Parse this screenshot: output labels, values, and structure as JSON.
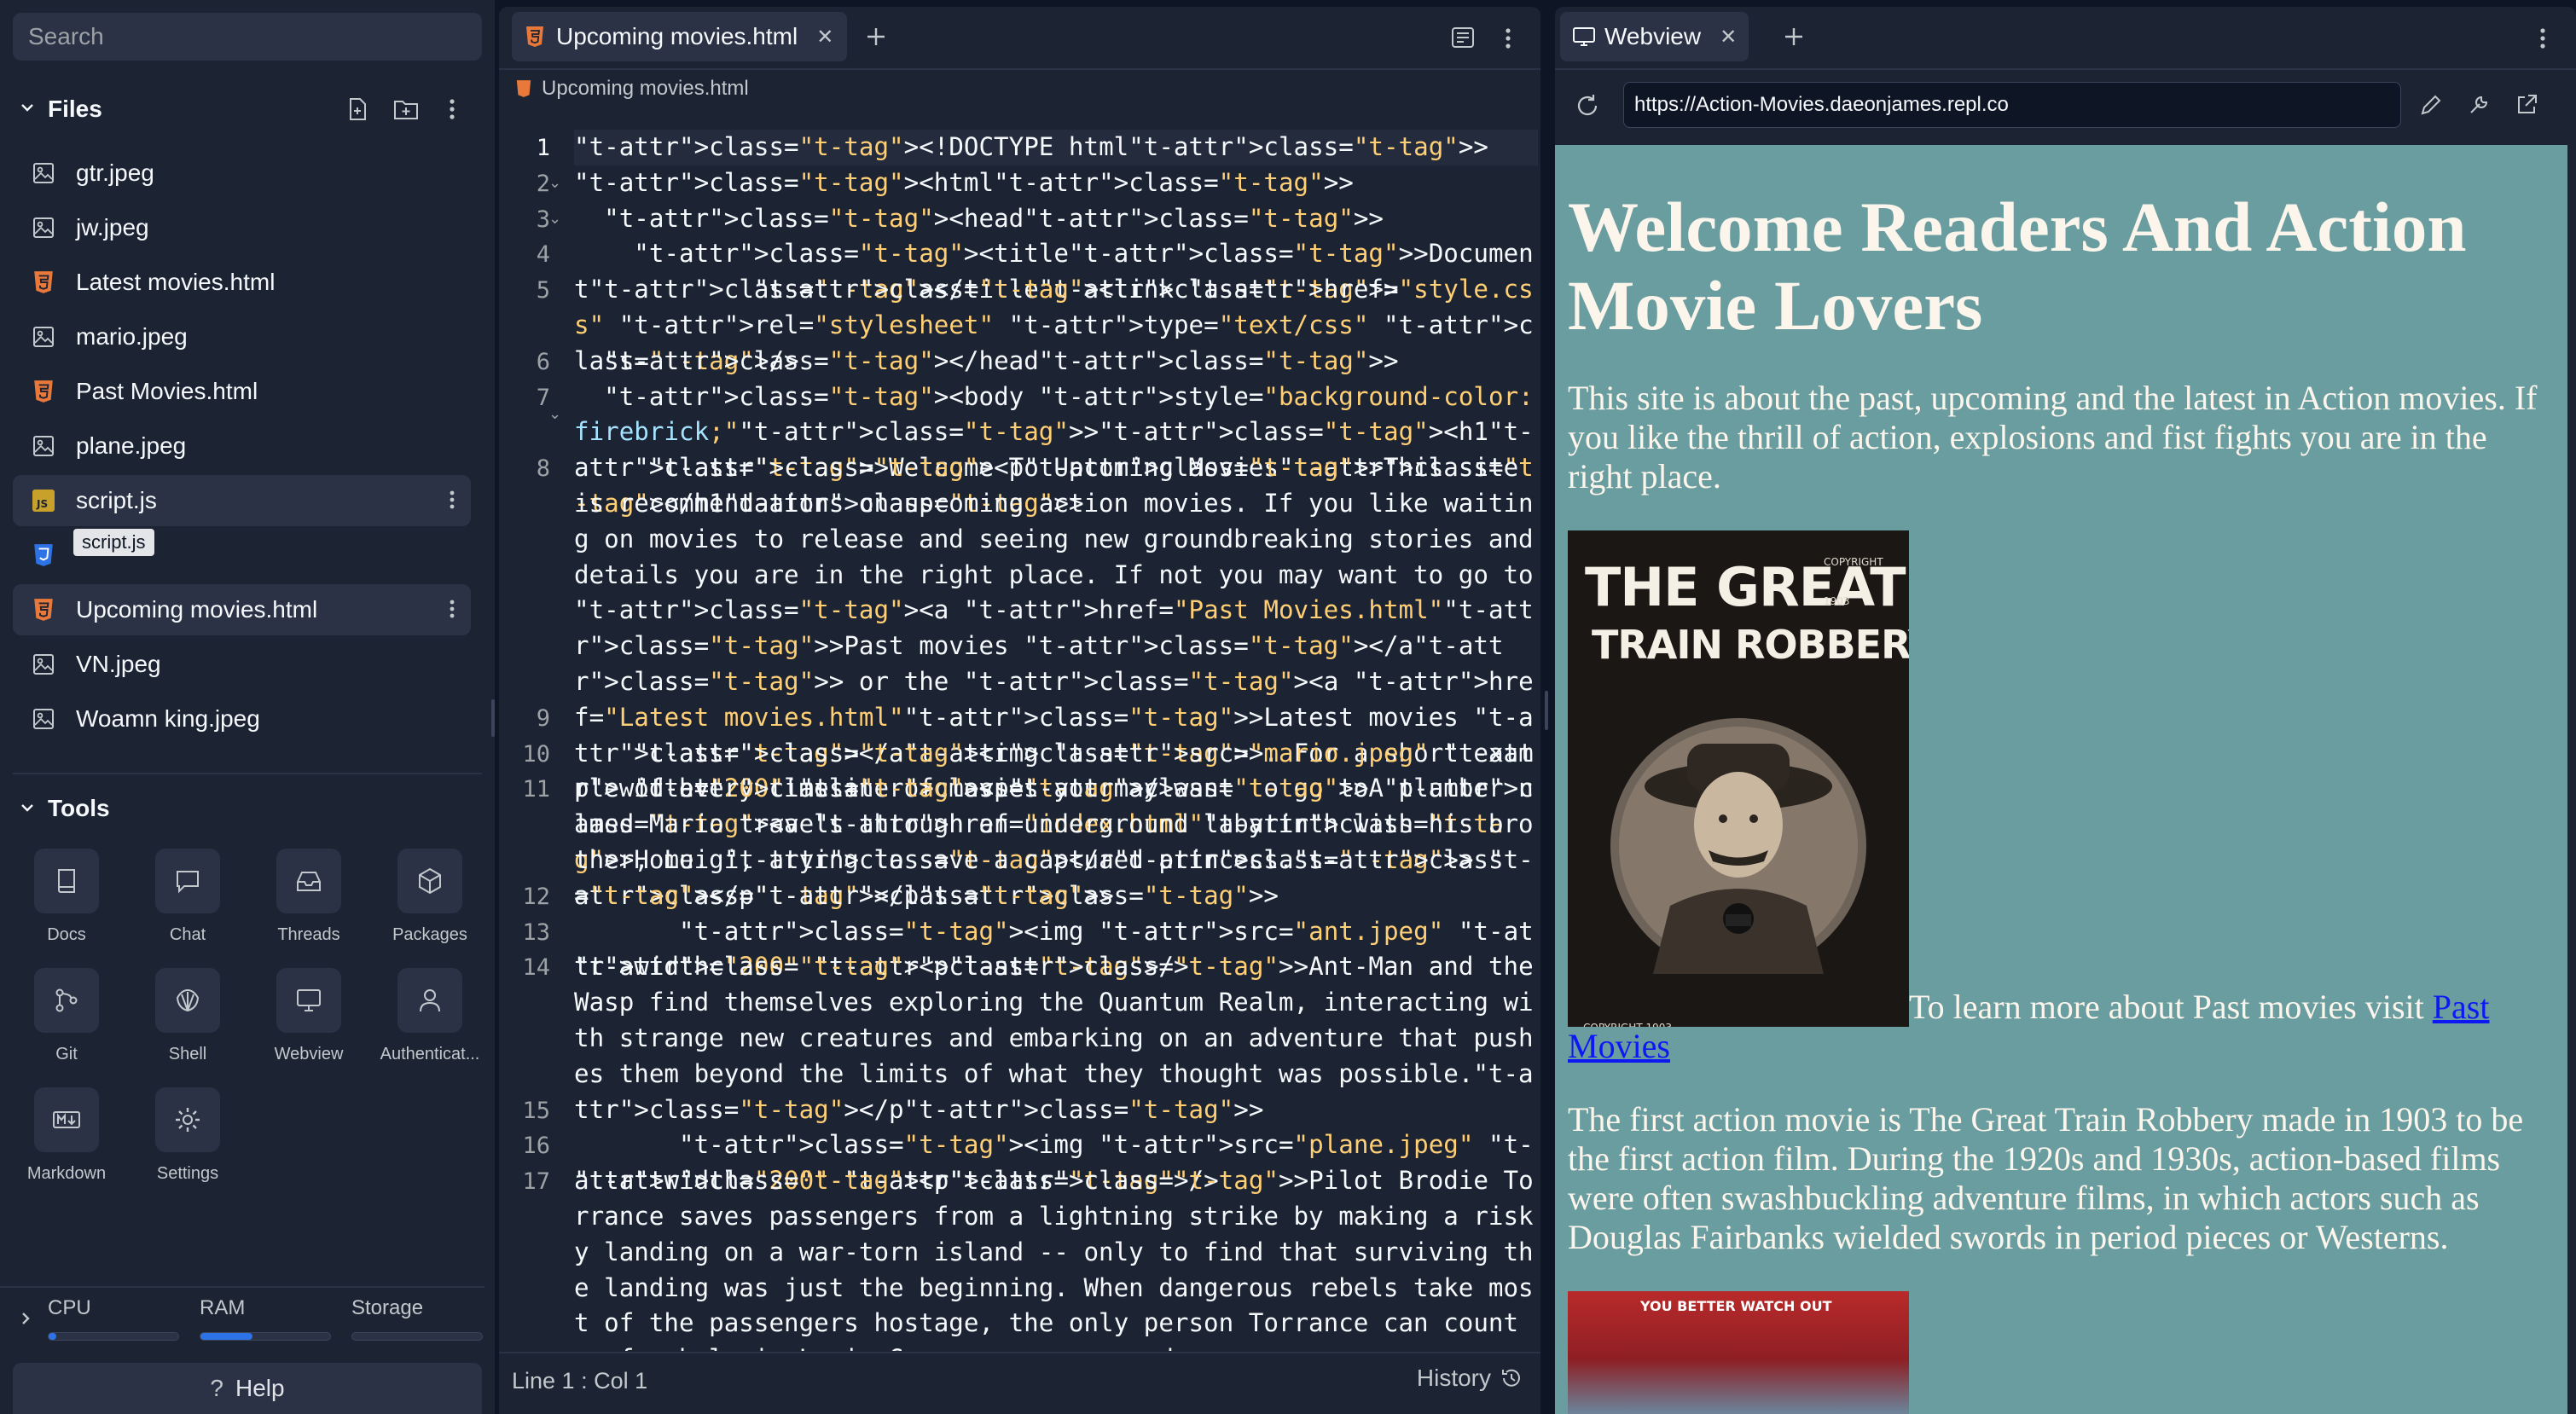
{
  "sidebar": {
    "search_placeholder": "Search",
    "files_header": "Files",
    "files": [
      {
        "name": "gtr.jpeg",
        "kind": "image"
      },
      {
        "name": "jw.jpeg",
        "kind": "image"
      },
      {
        "name": "Latest movies.html",
        "kind": "html"
      },
      {
        "name": "mario.jpeg",
        "kind": "image"
      },
      {
        "name": "Past Movies.html",
        "kind": "html"
      },
      {
        "name": "plane.jpeg",
        "kind": "image"
      },
      {
        "name": "script.js",
        "kind": "js"
      },
      {
        "name": "",
        "kind": "css"
      },
      {
        "name": "Upcoming movies.html",
        "kind": "html"
      },
      {
        "name": "VN.jpeg",
        "kind": "image"
      },
      {
        "name": "Woamn king.jpeg",
        "kind": "image"
      }
    ],
    "tooltip": "script.js",
    "tools_header": "Tools",
    "tools": [
      {
        "label": "Docs",
        "icon": "book-icon"
      },
      {
        "label": "Chat",
        "icon": "chat-icon"
      },
      {
        "label": "Threads",
        "icon": "inbox-icon"
      },
      {
        "label": "Packages",
        "icon": "package-icon"
      },
      {
        "label": "Git",
        "icon": "git-icon"
      },
      {
        "label": "Shell",
        "icon": "shell-icon"
      },
      {
        "label": "Webview",
        "icon": "monitor-icon"
      },
      {
        "label": "Authenticat...",
        "icon": "user-icon"
      },
      {
        "label": "Markdown",
        "icon": "markdown-icon"
      },
      {
        "label": "Settings",
        "icon": "gear-icon"
      }
    ],
    "resources": {
      "cpu_label": "CPU",
      "cpu_level": 0.06,
      "ram_label": "RAM",
      "ram_level": 0.4,
      "storage_label": "Storage",
      "storage_level": 0.0
    },
    "help_label": "Help"
  },
  "editor": {
    "tab_title": "Upcoming movies.html",
    "breadcrumb": "Upcoming movies.html",
    "status": "Line 1 : Col 1",
    "history_label": "History",
    "lines": [
      {
        "n": "1",
        "text": "<!DOCTYPE html>"
      },
      {
        "n": "2",
        "text": "<html>"
      },
      {
        "n": "3",
        "text": "  <head>"
      },
      {
        "n": "4",
        "text": "    <title>Document</title>"
      },
      {
        "n": "5",
        "text": "            <link href=\"style.css\" rel=\"stylesheet\" type=\"text/css\" />"
      },
      {
        "n": "6",
        "text": "  </head>"
      },
      {
        "n": "7",
        "text": "  <body style=\"background-color: firebrick;\"><h1>Welcome To Upcoming Movies</h1>"
      },
      {
        "n": "8",
        "text": "     <p>This site is recommendations on upcoming action movies. If you like waiting on movies to release and seeing new groundbreaking stories and details you are in the right place. If not you may want to go to <a href=\"Past Movies.html\">Past movies </a> or the <a href=\"Latest movies.html\">Latest movies </a>. For a short example of every timeline of movies you may want to go to <a href=\"index.html\">Home. </a> </p>"
      },
      {
        "n": "9",
        "text": ""
      },
      {
        "n": "10",
        "text": "    <img src=\"mario.jpeg\" width=\"200\" />"
      },
      {
        "n": "11",
        "text": "    <p>A plumber named Mario travels through an underground labyrinth with his brother, Luigi, trying to save a captured princess.</p>"
      },
      {
        "n": "12",
        "text": ""
      },
      {
        "n": "13",
        "text": "       <img src=\"ant.jpeg\" width=\"200\" />"
      },
      {
        "n": "14",
        "text": "<p>Ant-Man and the Wasp find themselves exploring the Quantum Realm, interacting with strange new creatures and embarking on an adventure that pushes them beyond the limits of what they thought was possible.</p>"
      },
      {
        "n": "15",
        "text": ""
      },
      {
        "n": "16",
        "text": "       <img src=\"plane.jpeg\" width=\"200\" />"
      },
      {
        "n": "17",
        "text": "<p>Pilot Brodie Torrance saves passengers from a lightning strike by making a risky landing on a war-torn island -- only to find that surviving the landing was just the beginning. When dangerous rebels take most of the passengers hostage, the only person Torrance can count on for help is Louis Gaspare, an accused"
      }
    ]
  },
  "webview": {
    "tab_title": "Webview",
    "url": "https://Action-Movies.daeonjames.repl.co",
    "page": {
      "heading": "Welcome Readers And Action Movie Lovers",
      "intro": "This site is about the past, upcoming and the latest in Action movies. If you like the thrill of action, explosions and fist fights you are in the right place.",
      "poster_title_1": "THE GREAT",
      "poster_title_2": "TRAIN ROBBERY",
      "poster_copyright": "COPYRIGHT 1903",
      "learn_more": "To learn more about Past movies visit ",
      "past_link": "Past Movies",
      "history_text": "The first action movie is The Great Train Robbery made in 1903 to be the first action film. During the 1920s and 1930s, action-based films were often swashbuckling adventure films, in which actors such as Douglas Fairbanks wielded swords in period pieces or Westerns.",
      "poster2_caption": "YOU BETTER WATCH OUT"
    }
  }
}
